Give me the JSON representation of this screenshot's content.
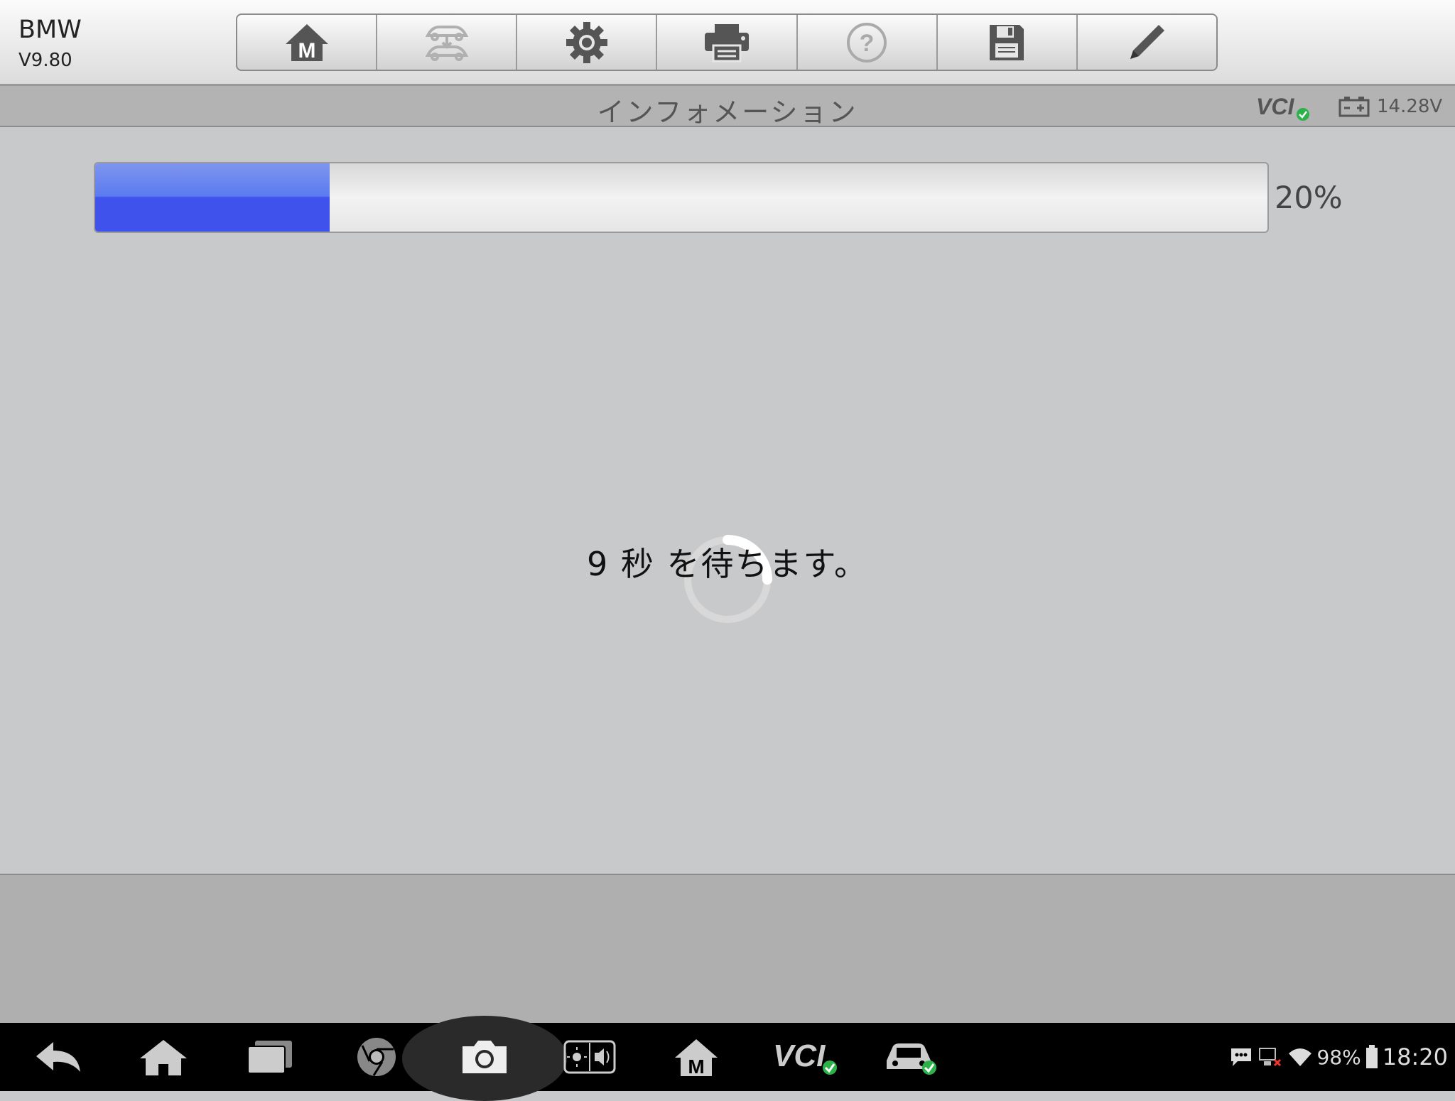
{
  "header": {
    "app_name": "BMW",
    "app_version": "V9.80"
  },
  "toolbar": {
    "buttons": [
      {
        "name": "home-m",
        "icon": "home-m-icon",
        "enabled": true
      },
      {
        "name": "vehicle-swap",
        "icon": "vehicle-swap-icon",
        "enabled": false
      },
      {
        "name": "settings",
        "icon": "gear-icon",
        "enabled": true
      },
      {
        "name": "print",
        "icon": "printer-icon",
        "enabled": true
      },
      {
        "name": "help",
        "icon": "help-icon",
        "enabled": false
      },
      {
        "name": "save",
        "icon": "floppy-disk-icon",
        "enabled": true
      },
      {
        "name": "edit",
        "icon": "pencil-icon",
        "enabled": true
      }
    ]
  },
  "title_bar": {
    "title": "インフォメーション",
    "vci_label": "VCI",
    "voltage": "14.28V"
  },
  "progress": {
    "percent_label": "20%",
    "fraction": 0.2
  },
  "wait_message": "9 秒 を待ちます。",
  "status_bar": {
    "battery_pct": "98%",
    "time": "18:20"
  },
  "nav": {
    "vci_label": "VCI"
  },
  "colors": {
    "progress_fill": "#3f52ec",
    "status_ok": "#2bb34a"
  }
}
